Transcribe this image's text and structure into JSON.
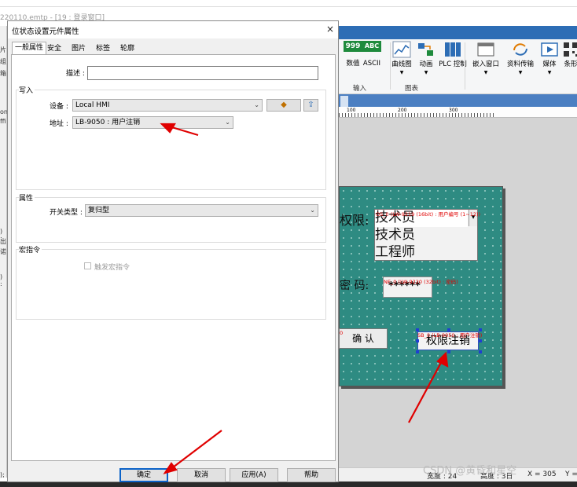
{
  "background_app": {
    "title_fragment": "220110.emtp - [19 : 登录窗口]",
    "left_strip_labels": [
      "片",
      "组",
      "箱",
      "on",
      "ffi",
      ") :",
      "出",
      "诺",
      ") :",
      ");"
    ],
    "ribbon_buttons": [
      {
        "icon": "numeric-icon",
        "label": "数值"
      },
      {
        "icon": "ascii-icon",
        "label": "ASCII"
      },
      {
        "icon": "trend-chart-icon",
        "label": "曲线图"
      },
      {
        "icon": "animation-icon",
        "label": "动画"
      },
      {
        "icon": "plc-control-icon",
        "label": "PLC 控制"
      },
      {
        "icon": "embed-window-icon",
        "label": "嵌入窗口"
      },
      {
        "icon": "data-transfer-icon",
        "label": "资料传输"
      },
      {
        "icon": "media-icon",
        "label": "媒体"
      },
      {
        "icon": "barcode-icon",
        "label": "条形"
      }
    ],
    "ribbon_group_input": "输入",
    "ribbon_group_chart": "图表",
    "numeric_icon_text": "999",
    "ascii_icon_text": "ABC",
    "ruler_marks": [
      "100",
      "200",
      "300"
    ],
    "hmi_screen": {
      "permission_label": "权限:",
      "permission_tag": "OS_0 (LW-9219 (16bit) : 用户编号 (1~12))",
      "permission_items": [
        "技术员",
        "技术员",
        "工程师"
      ],
      "password_label": "密 码:",
      "password_tag": "NE_0 (LW-9220 (32bit) : 密码)",
      "password_value": "******",
      "confirm_prefix": "0",
      "confirm_label": "确 认",
      "logout_tag": "SB_0 (LB-9050 : 用户注销)",
      "logout_label": "权限注销"
    },
    "status_bar": {
      "width": "宽度 : 24",
      "height": "高度 : 3日",
      "x": "X = 305",
      "y": "Y ="
    },
    "watermark": "CSDN @黄昏和星空",
    "colors": {
      "ribbon_blue": "#2d6db5",
      "hmi_teal": "#2e8b82",
      "annotation_red": "#e00000",
      "selection_blue": "#1f3fd0"
    }
  },
  "dialog": {
    "title": "位状态设置元件属性",
    "close_glyph": "×",
    "tabs": [
      "一般属性",
      "安全",
      "图片",
      "标签",
      "轮廓"
    ],
    "active_tab": "一般属性",
    "description_label": "描述 :",
    "description_value": "",
    "write_group": "写入",
    "device_label": "设备 :",
    "device_value": "Local HMI",
    "address_label": "地址 :",
    "address_value": "LB-9050 : 用户注销",
    "property_group": "属性",
    "switch_type_label": "开关类型 :",
    "switch_type_value": "复归型",
    "macro_group": "宏指令",
    "macro_checkbox_label": "触发宏指令",
    "macro_checked": false,
    "buttons": {
      "ok": "确定",
      "cancel": "取消",
      "apply": "应用(A)",
      "help": "帮助"
    }
  }
}
